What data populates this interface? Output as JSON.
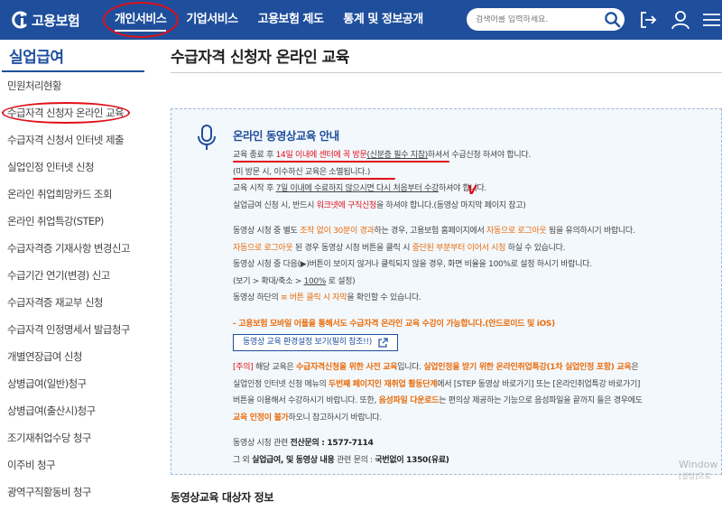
{
  "header": {
    "logo_text": "고용보험",
    "nav": [
      "개인서비스",
      "기업서비스",
      "고용보험 제도",
      "통계 및 정보공개"
    ],
    "active_nav": "개인서비스",
    "search_placeholder": "검색어를 입력하세요."
  },
  "sidebar": {
    "title": "실업급여",
    "items": [
      "민원처리현황",
      "수급자격 신청자 온라인 교육",
      "수급자격 신청서 인터넷 제출",
      "실업인정 인터넷 신청",
      "온라인 취업희망카드 조회",
      "온라인 취업특강(STEP)",
      "수급자격증 기재사항 변경신고",
      "수급기간 연기(변경) 신고",
      "수급자격증 재교부 신청",
      "수급자격 인정명세서 발급청구",
      "개별연장급여 신청",
      "상병급여(일반)청구",
      "상병급여(출산시)청구",
      "조기재취업수당 청구",
      "이주비 청구",
      "광역구직활동비 청구"
    ],
    "selected_index": 1
  },
  "main": {
    "title": "수급자격 신청자 온라인 교육",
    "section_title": "동영상교육 대상자 정보"
  },
  "notice": {
    "title": "온라인 동영상교육 안내",
    "p1": {
      "a": "교육 종료 후 ",
      "b": "14일 이내에 센터에 꼭 방문",
      "c": "(신분증 필수 지참)",
      "d": "하셔서 수급신청 하셔야 합니다.",
      "line2": "(미 방문 시, 이수하신 교육은 소멸됩니다.)",
      "line3_a": "교육 시작 후 ",
      "line3_b": "7일 이내에 수료하지 않으시면 다시 처음부터 수강",
      "line3_c": "하셔야 합니다.",
      "line4_a": "실업급여 신청 시, 반드시 ",
      "line4_b": "워크넷에 구직신청",
      "line4_c": "을 하셔야 합니다.(동영상 마지막 페이지 참고)"
    },
    "p2": {
      "l1_a": "동영상 시청 중 별도 ",
      "l1_b": "조작 없이 30분이 경과",
      "l1_c": "하는 경우, 고용보험 홈페이지에서 ",
      "l1_d": "자동으로 로그아웃",
      "l1_e": " 됨을 유의하시기 바랍니다.",
      "l2_a": "자동으로 로그아웃",
      "l2_b": " 된 경우 동영상 시청 버튼을 클릭 시 ",
      "l2_c": "중단된 부분부터 이어서 시청",
      "l2_d": " 하실 수 있습니다.",
      "l3": "동영상 시청 중 다음(▶)버튼이 보이지 않거나 클릭되지 않을 경우, 화면 비율을 100%로 설정 하시기 바랍니다.",
      "l4_a": "(보기 > 확대/축소 > ",
      "l4_b": "100%",
      "l4_c": " 로 설정)",
      "l5_a": "동영상 하단의 ",
      "l5_b": "≡ 버튼 클릭 시 자막",
      "l5_c": "을 확인할 수 있습니다."
    },
    "mobile": "- 고용보험 모바일 어플을 통해서도 수급자격 온라인 교육 수강이 가능합니다.(안드로이드 및 iOS)",
    "video_button": "동영상 교육 환경설정 보기(필히 참조!!)",
    "p3": {
      "l1_a": "[주의]",
      "l1_b": " 해당 교육은 ",
      "l1_c": "수급자격신청을 위한 사전 교육",
      "l1_d": "입니다. ",
      "l1_e": "실업인정을 받기 위한 온라인취업특강(1차 실업인정 포함) 교육",
      "l1_f": "은",
      "l2_a": "실업인정 인터넷 신청 메뉴의 ",
      "l2_b": "두번째 페이지인 재취업 활동단계",
      "l2_c": "에서 [STEP 동영상 바로가기] 또는 [온라인취업특강 바로가기]",
      "l3_a": "버튼을 이용해서 수강하시기 바랍니다. 또한, ",
      "l3_b": "음성파일 다운로드",
      "l3_c": "는 편의상 제공하는 기능으로 음성파일을 끝까지 들은 경우에도",
      "l4_a": "교육 인정이 불가",
      "l4_b": "하오니 참고하시기 바랍니다."
    },
    "p4": {
      "l1_a": "동영상 시청 관련 ",
      "l1_b": "전산문의 : 1577-7114",
      "l2_a": "그 외 ",
      "l2_b": "실업급여, 및 동영상 내용",
      "l2_c": " 관련 문의 : ",
      "l2_d": "국번없이 1350(유료)"
    }
  },
  "watermark": {
    "line1": "Window",
    "line2": "[설정]으로"
  },
  "annotation": {
    "check_mark": "V"
  },
  "colors": {
    "brand": "#1f4f9c",
    "red": "#e0101a",
    "orange": "#e96c0c",
    "annotation": "#e0101a"
  }
}
